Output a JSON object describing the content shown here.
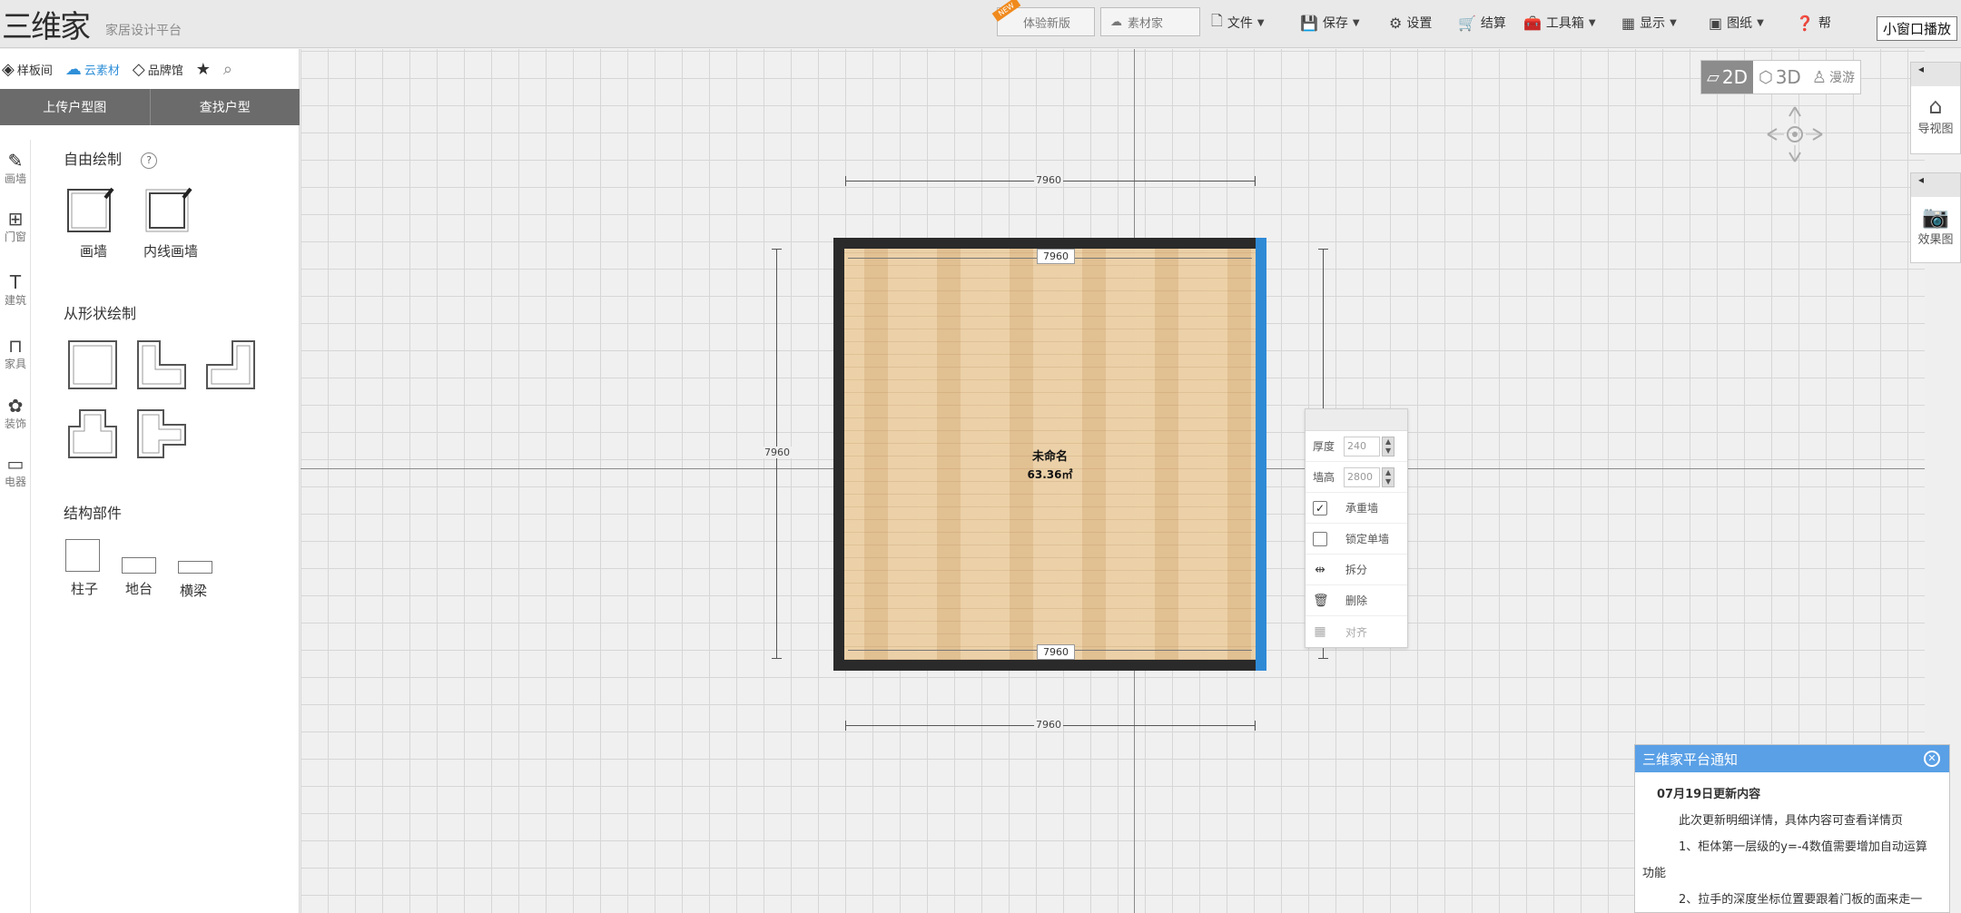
{
  "topbar": {
    "logo_mark": "三维家",
    "logo_sub": "家居设计平台",
    "trial": "体验新版",
    "material_home": "素材家",
    "menus": {
      "file": "文件",
      "save": "保存",
      "settings": "设置",
      "checkout": "结算",
      "toolbox": "工具箱",
      "display": "显示",
      "drawings": "图纸",
      "help": "帮"
    },
    "small_window_button": "小窗口播放",
    "tooltip": "小窗口播放"
  },
  "library": {
    "tabs": [
      "样板间",
      "云素材",
      "品牌馆"
    ],
    "upload_floorplan": "上传户型图",
    "search_floorplan": "查找户型"
  },
  "vnav": [
    "画墙",
    "门窗",
    "建筑",
    "家具",
    "装饰",
    "电器"
  ],
  "tools": {
    "free_draw_title": "自由绘制",
    "help_symbol": "?",
    "draw_wall": "画墙",
    "draw_inner_wall": "内线画墙",
    "shape_draw_title": "从形状绘制",
    "structure_title": "结构部件",
    "column": "柱子",
    "platform": "地台",
    "beam": "横梁"
  },
  "room": {
    "name": "未命名",
    "area": "63.36㎡",
    "dim_top_inner": "7960",
    "dim_bottom_inner": "7960",
    "dim_top_outer": "7960",
    "dim_bottom_outer": "7960",
    "dim_left": "7960"
  },
  "wall_props": {
    "thickness_label": "厚度",
    "thickness_value": "240",
    "height_label": "墙高",
    "height_value": "2800",
    "load_bearing_label": "承重墙",
    "lock_single_label": "锁定单墙",
    "split_label": "拆分",
    "delete_label": "删除",
    "align_label": "对齐"
  },
  "view": {
    "mode_2d": "2D",
    "mode_3d": "3D",
    "roam": "漫游",
    "nav_map": "导视图",
    "render": "效果图"
  },
  "notice": {
    "title": "三维家平台通知",
    "close": "✕",
    "update_title": "07月19日更新内容",
    "line1": "此次更新明细详情，具体内容可查看详情页",
    "line2": "1、柜体第一层级的y=-4数值需要增加自动运算",
    "line3": "功能",
    "line4": "2、拉手的深度坐标位置要跟着门板的面来走一"
  },
  "colors": {
    "accent_blue": "#2f8ad6",
    "notice_header": "#5aa0e6",
    "floor": "#e6c79a",
    "wall": "#2a2a2a"
  }
}
